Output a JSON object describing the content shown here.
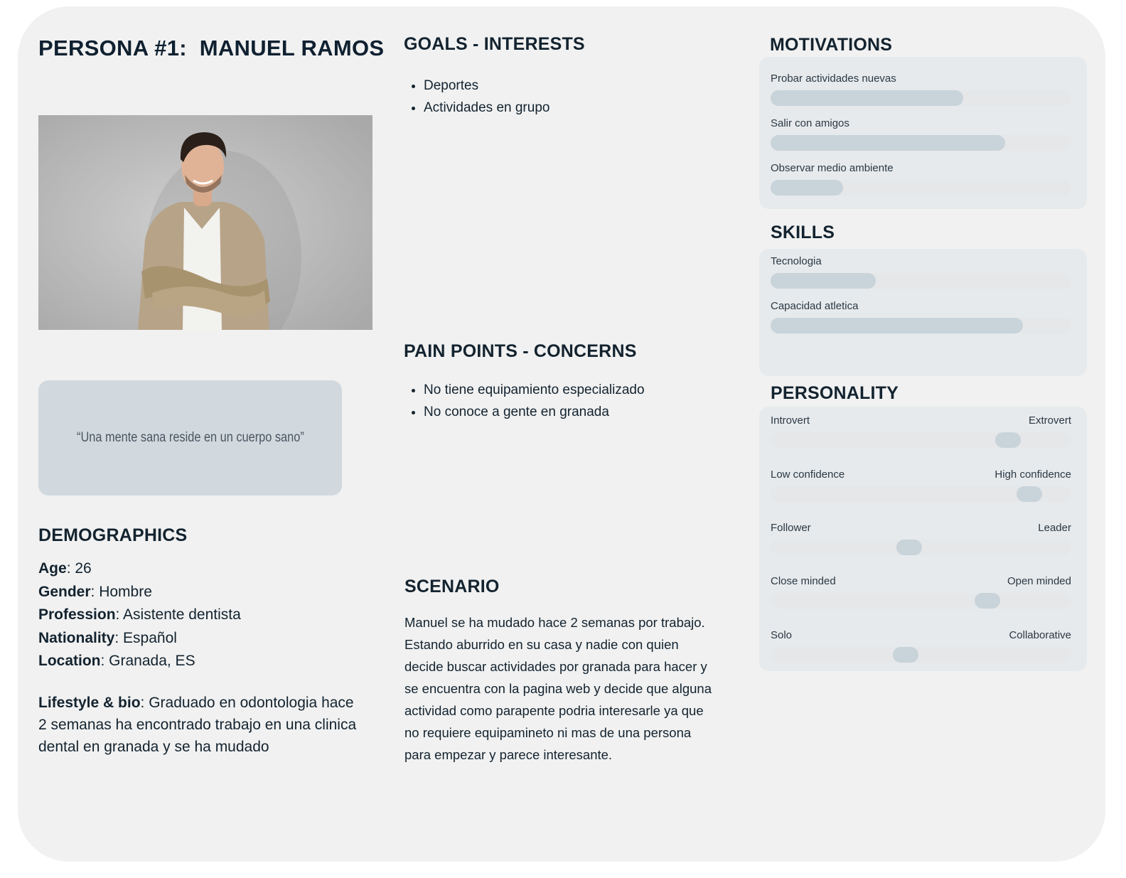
{
  "title": "PERSONA #1:  MANUEL RAMOS",
  "quote": "“Una mente sana reside en un cuerpo sano”",
  "demographics": {
    "heading": "DEMOGRAPHICS",
    "rows": [
      {
        "label": "Age",
        "value": ": 26"
      },
      {
        "label": "Gender",
        "value": ": Hombre"
      },
      {
        "label": "Profession",
        "value": ": Asistente dentista"
      },
      {
        "label": "Nationality",
        "value": ": Español"
      },
      {
        "label": "Location",
        "value": ": Granada, ES"
      }
    ],
    "bio_label": "Lifestyle & bio",
    "bio_value": ": Graduado en odontologia hace 2 semanas ha encontrado trabajo en una clinica dental en granada y se ha mudado"
  },
  "goals": {
    "heading": "GOALS - INTERESTS",
    "items": [
      "Deportes",
      "Actividades en grupo"
    ]
  },
  "pain_points": {
    "heading": "PAIN POINTS - CONCERNS",
    "items": [
      "No tiene equipamiento especializado",
      "No conoce a gente en granada"
    ]
  },
  "scenario": {
    "heading": "SCENARIO",
    "text": "Manuel se ha mudado hace 2 semanas por trabajo. Estando aburrido en su casa y nadie con quien decide buscar actividades por granada para hacer y se encuentra con la pagina web y decide que alguna actividad como parapente podria interesarle ya que no requiere equipamineto ni mas de una persona para empezar y parece interesante."
  },
  "motivations": {
    "heading": "MOTIVATIONS",
    "items": [
      {
        "label": "Probar actividades nuevas",
        "level": 0.64
      },
      {
        "label": "Salir con amigos",
        "level": 0.78
      },
      {
        "label": "Observar medio ambiente",
        "level": 0.24
      }
    ]
  },
  "skills": {
    "heading": "SKILLS",
    "items": [
      {
        "label": "Tecnologia",
        "level": 0.35
      },
      {
        "label": "Capacidad atletica",
        "level": 0.84
      }
    ]
  },
  "personality": {
    "heading": "PERSONALITY",
    "items": [
      {
        "left": "Introvert",
        "right": "Extrovert",
        "level": 0.79
      },
      {
        "left": "Low confidence",
        "right": "High confidence",
        "level": 0.86
      },
      {
        "left": "Follower",
        "right": "Leader",
        "level": 0.46
      },
      {
        "left": "Close minded",
        "right": "Open minded",
        "level": 0.72
      },
      {
        "left": "Solo",
        "right": "Collaborative",
        "level": 0.45
      }
    ]
  }
}
